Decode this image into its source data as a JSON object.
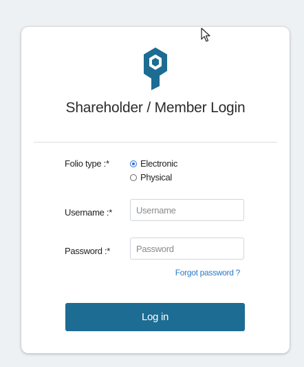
{
  "title": "Shareholder / Member Login",
  "form": {
    "folio_type_label": "Folio type :*",
    "folio_options": [
      {
        "label": "Electronic",
        "checked": true
      },
      {
        "label": "Physical",
        "checked": false
      }
    ],
    "username_label": "Username :*",
    "username_placeholder": "Username",
    "password_label": "Password :*",
    "password_placeholder": "Password",
    "forgot_label": "Forgot password ?",
    "login_label": "Log in"
  },
  "colors": {
    "brand": "#1c6c93",
    "link": "#2a78c7",
    "radio_active": "#2a6fd6"
  },
  "icons": {
    "logo": "brand-logo-icon",
    "cursor": "mouse-pointer-icon"
  }
}
